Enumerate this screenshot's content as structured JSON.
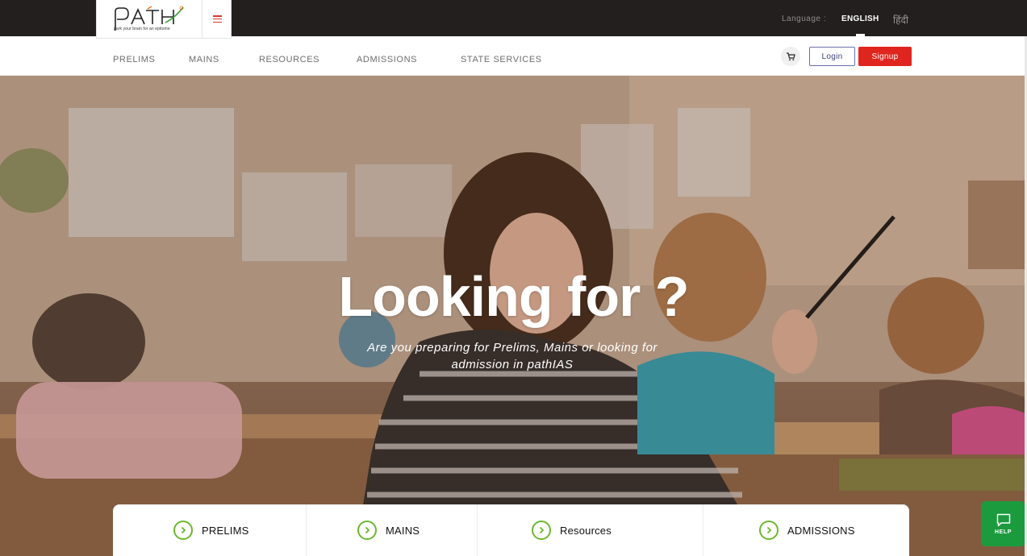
{
  "brand": {
    "logo_text": "PATH",
    "tagline": "park your brain for an epitome"
  },
  "topbar": {
    "language_label": "Language :",
    "lang_english": "ENGLISH",
    "lang_hindi": "हिंदी"
  },
  "nav": {
    "items": [
      {
        "label": "PRELIMS"
      },
      {
        "label": "MAINS"
      },
      {
        "label": "RESOURCES"
      },
      {
        "label": "ADMISSIONS"
      },
      {
        "label": "STATE SERVICES"
      }
    ],
    "login_label": "Login",
    "signup_label": "Signup"
  },
  "hero": {
    "title": "Looking for ?",
    "subtitle": "Are you preparing for Prelims, Mains or looking for admission in pathIAS"
  },
  "categories": [
    {
      "label": "PRELIMS"
    },
    {
      "label": "MAINS"
    },
    {
      "label": "Resources"
    },
    {
      "label": "ADMISSIONS"
    }
  ],
  "help": {
    "label": "HELP"
  },
  "colors": {
    "topbar": "#231f1e",
    "signup": "#e0251f",
    "accent_green": "#6cb72f",
    "help_green": "#1b9b3d"
  }
}
